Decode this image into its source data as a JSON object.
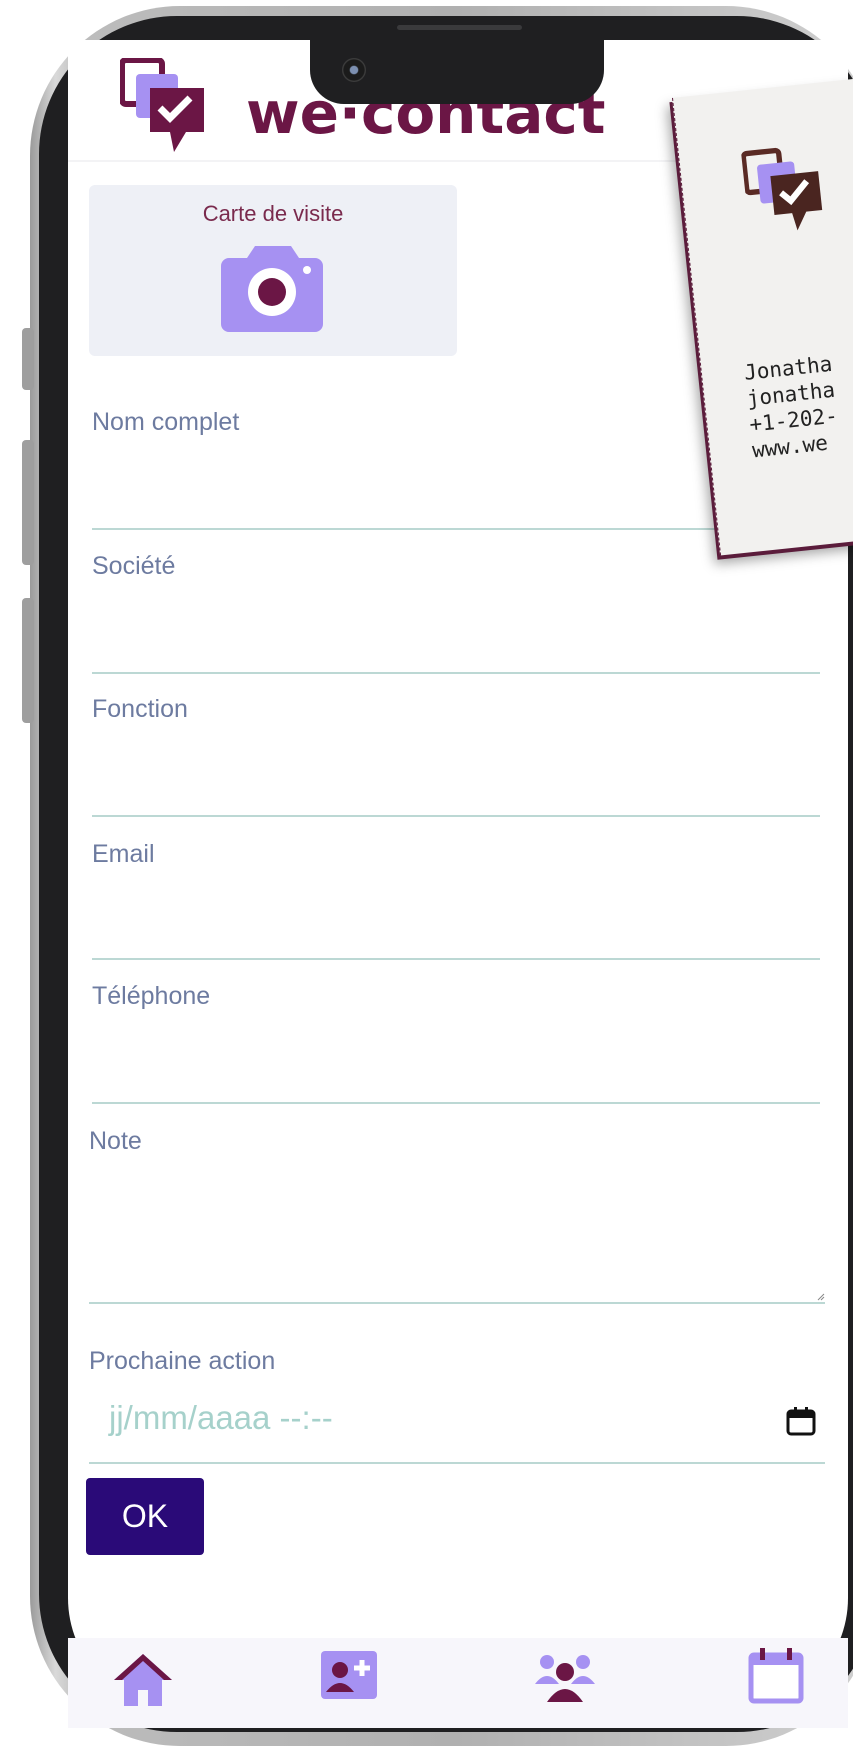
{
  "brand": {
    "name": "we·contact"
  },
  "menu": {
    "icon": "hamburger-menu-icon"
  },
  "photo_card": {
    "label": "Carte de visite",
    "icon": "camera-icon"
  },
  "business_card": {
    "lines": [
      "Jonatha",
      "jonatha",
      "+1-202-",
      "www.we"
    ]
  },
  "form": {
    "full_name_label": "Nom complet",
    "company_label": "Société",
    "function_label": "Fonction",
    "email_label": "Email",
    "phone_label": "Téléphone",
    "note_label": "Note",
    "next_action_label": "Prochaine action",
    "next_action_placeholder": "jj/mm/aaaa --:--",
    "ok_label": "OK"
  },
  "bottom_nav": {
    "items": [
      {
        "name": "home",
        "icon": "home-icon"
      },
      {
        "name": "add-contact",
        "icon": "add-contact-icon"
      },
      {
        "name": "contacts",
        "icon": "group-icon"
      },
      {
        "name": "calendar",
        "icon": "calendar-icon"
      }
    ]
  },
  "colors": {
    "brand": "#6b1645",
    "accent": "#8a79e6",
    "button": "#2a0a78",
    "label": "#6d7ba0",
    "underline": "#bcd8d4"
  }
}
